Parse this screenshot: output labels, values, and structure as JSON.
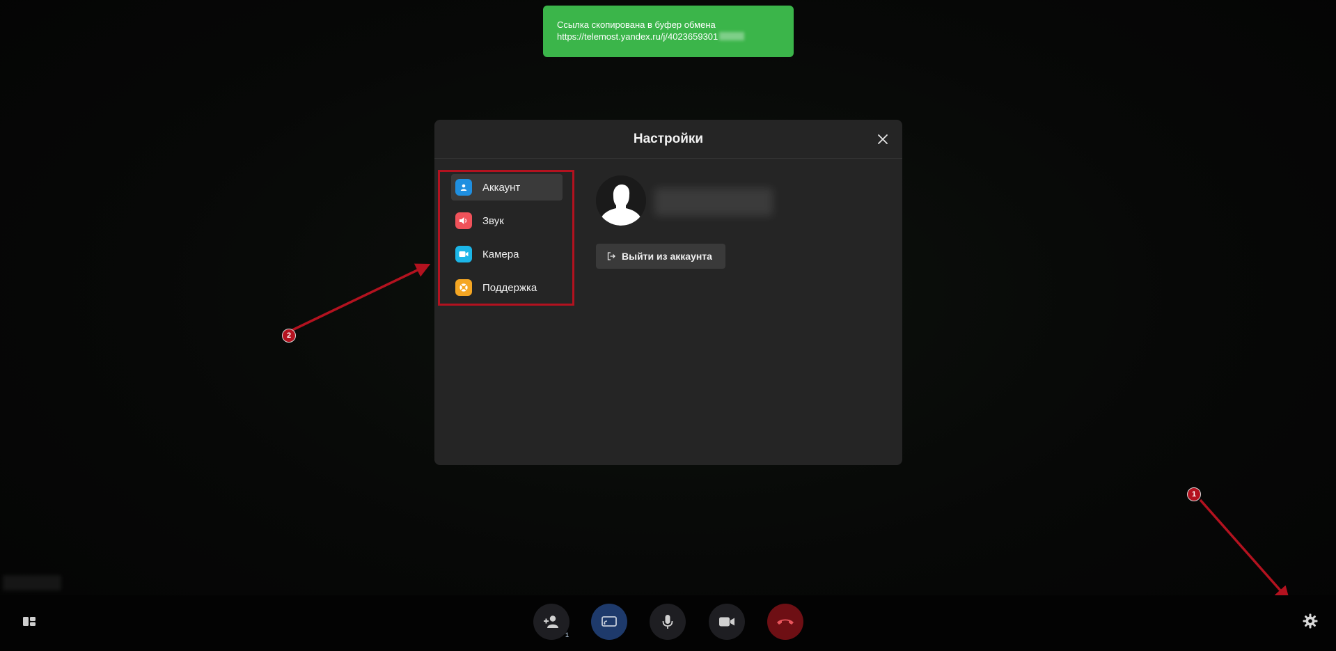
{
  "toast": {
    "line1": "Ссылка скопирована в буфер обмена",
    "line2": "https://telemost.yandex.ru/j/4023659301"
  },
  "modal": {
    "title": "Настройки",
    "nav": [
      {
        "label": "Аккаунт",
        "icon": "user-icon",
        "color": "#1f8fe0"
      },
      {
        "label": "Звук",
        "icon": "speaker-icon",
        "color": "#f0525a"
      },
      {
        "label": "Камера",
        "icon": "camera-icon",
        "color": "#1cb6e8"
      },
      {
        "label": "Поддержка",
        "icon": "lifebuoy-icon",
        "color": "#f5a623"
      }
    ],
    "logout_label": "Выйти из аккаунта"
  },
  "annotations": {
    "badge1": "1",
    "badge2": "2",
    "color": "#b3121f"
  },
  "controls": {
    "participants_count": "1",
    "screen_share_color": "#1e3a6b",
    "hangup_color": "#6e0f14",
    "button_color": "#1e1e22"
  }
}
